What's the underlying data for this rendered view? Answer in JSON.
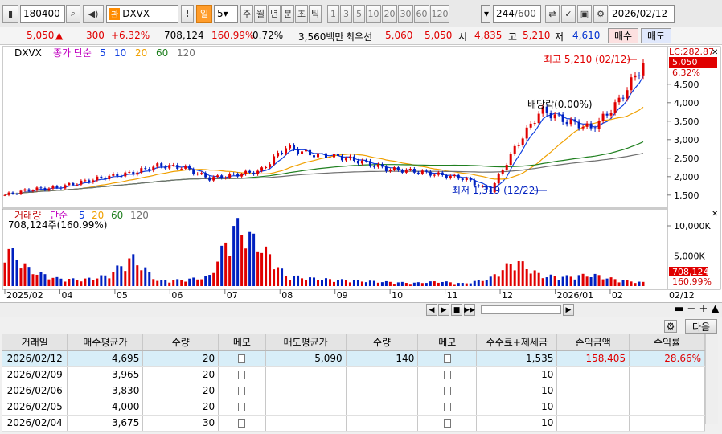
{
  "toolbar": {
    "stock_code": "180400",
    "stock_name": "DXVX",
    "tab_day": "일",
    "day_count": "5",
    "periods": [
      "주",
      "월",
      "년",
      "분",
      "초",
      "틱"
    ],
    "minute_options": [
      "1",
      "3",
      "5",
      "10",
      "20",
      "30",
      "60",
      "120"
    ],
    "count_value": "244",
    "count_total": "/600",
    "date": "2026/02/12",
    "exclaim": "!"
  },
  "info": {
    "price": "5,050",
    "arrow": "▲",
    "change": "300",
    "change_pct": "+6.32%",
    "volume": "708,124",
    "vol_ratio": "160.99%",
    "turnover": "0.72%",
    "amount": "3,560백만",
    "best_quote_label": "최우선",
    "ask": "5,060",
    "bid": "5,050",
    "open_label": "시",
    "open": "4,835",
    "high_label": "고",
    "high": "5,210",
    "low_label": "저",
    "low": "4,610",
    "buy": "매수",
    "sell": "매도"
  },
  "chart": {
    "legend_name": "DXVX",
    "legend_ma_label": "종가 단순",
    "legend_ma": [
      "5",
      "10",
      "20",
      "60",
      "120"
    ],
    "lc": "LC:282.87",
    "last_price": "5,050",
    "last_pct": "6.32%",
    "price_ticks": [
      "4,500",
      "4,000",
      "3,500",
      "3,000",
      "2,500",
      "2,000",
      "1,500"
    ],
    "high_annotation": "최고 5,210 (02/12)",
    "low_annotation": "최저 1,319 (12/22)",
    "dividend_annotation": "배당락(0.00%)",
    "volume_legend": "거래량",
    "volume_ma_label": "단순",
    "volume_ma": [
      "5",
      "20",
      "60",
      "120"
    ],
    "volume_value": "708,124주(160.99%)",
    "volume_ticks": [
      "10,000K",
      "5,000K"
    ],
    "last_volume": "708,124",
    "last_volume_pct": "160.99%",
    "date_ticks": [
      "2025/02",
      "04",
      "05",
      "06",
      "07",
      "08",
      "09",
      "10",
      "11",
      "12",
      "2026/01",
      "02",
      "02/12"
    ],
    "colors": {
      "up": "#e00000",
      "down": "#0020c0",
      "ma5": "#1040e0",
      "ma20": "#f0a000",
      "ma60": "#208020",
      "ma120": "#707070"
    }
  },
  "chart_data": {
    "type": "candlestick",
    "title": "DXVX",
    "x": [
      "2025/02",
      "04",
      "05",
      "06",
      "07",
      "08",
      "09",
      "10",
      "11",
      "12",
      "2026/01",
      "02",
      "02/12"
    ],
    "price_series": [
      1500,
      1650,
      1700,
      1850,
      2000,
      2100,
      2300,
      2250,
      1950,
      2050,
      2150,
      2800,
      2600,
      2550,
      2400,
      2200,
      2150,
      2050,
      1950,
      1600,
      2800,
      3800,
      3500,
      3300,
      4000,
      5050
    ],
    "ylim": [
      1300,
      5300
    ],
    "volume_series": [
      7800,
      3000,
      1500,
      1200,
      2000,
      5500,
      1000,
      1200,
      1800,
      11800,
      8000,
      2000,
      1500,
      1200,
      1000,
      800,
      600,
      900,
      500,
      1500,
      5000,
      2000,
      1800,
      2200,
      1200,
      708
    ],
    "volume_ylim": [
      0,
      12000
    ],
    "annotations": [
      "최고 5,210 (02/12)",
      "최저 1,319 (12/22)",
      "배당락(0.00%)"
    ]
  },
  "bottom": {
    "controls": [
      "◀",
      "▶",
      "◀◀",
      "■",
      "▶▶",
      "◀"
    ],
    "zoom": [
      "—",
      "−",
      "+",
      "▲"
    ],
    "next": "다음"
  },
  "table": {
    "headers": [
      "거래일",
      "매수평균가",
      "수량",
      "메모",
      "매도평균가",
      "수량",
      "메모",
      "수수료+제세금",
      "손익금액",
      "수익률"
    ],
    "rows": [
      [
        "2026/02/12",
        "4,695",
        "20",
        "",
        "5,090",
        "140",
        "",
        "1,535",
        "158,405",
        "28.66%"
      ],
      [
        "2026/02/09",
        "3,965",
        "20",
        "",
        "",
        "",
        "",
        "10",
        "",
        ""
      ],
      [
        "2026/02/06",
        "3,830",
        "20",
        "",
        "",
        "",
        "",
        "10",
        "",
        ""
      ],
      [
        "2026/02/05",
        "4,000",
        "20",
        "",
        "",
        "",
        "",
        "10",
        "",
        ""
      ],
      [
        "2026/02/04",
        "3,675",
        "30",
        "",
        "",
        "",
        "",
        "10",
        "",
        ""
      ]
    ]
  }
}
